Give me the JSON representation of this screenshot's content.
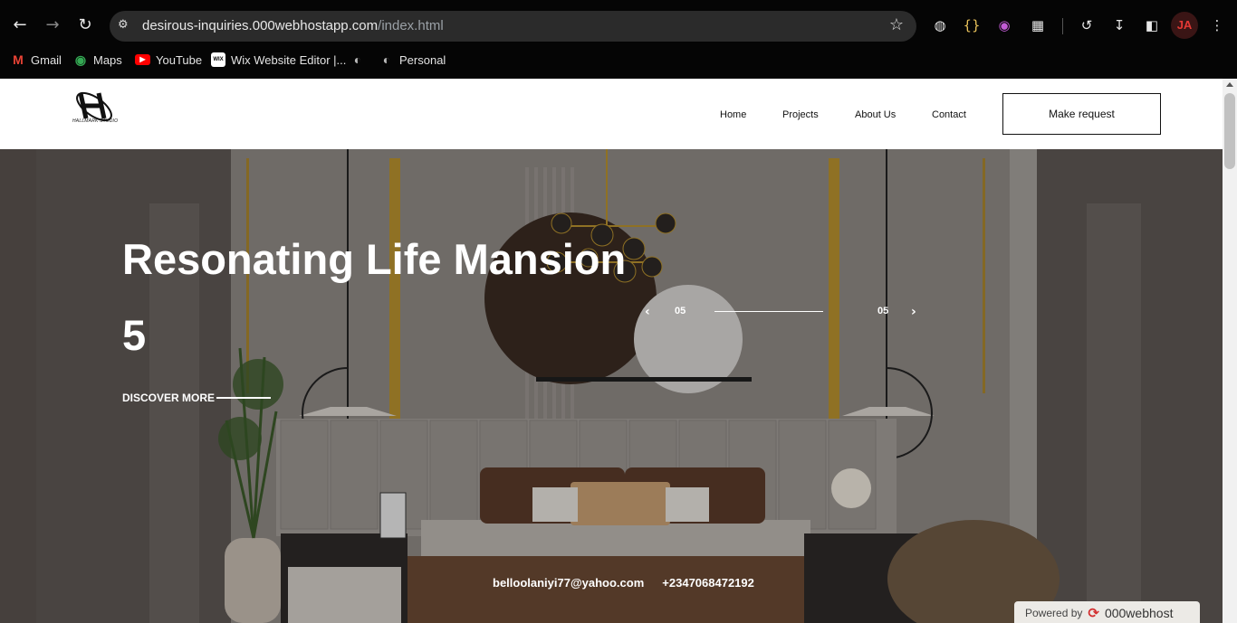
{
  "browser": {
    "url_host": "desirous-inquiries.000webhostapp.com",
    "url_path": "/index.html",
    "profile_initials": "JA",
    "bookmarks": [
      {
        "label": "Gmail",
        "icon": "gmail-icon"
      },
      {
        "label": "Maps",
        "icon": "maps-icon"
      },
      {
        "label": "YouTube",
        "icon": "youtube-icon"
      },
      {
        "label": "Wix Website Editor |...",
        "icon": "wix-icon"
      },
      {
        "label": "",
        "icon": "globe-icon"
      },
      {
        "label": "Personal",
        "icon": "globe-icon"
      }
    ],
    "extension_icons": [
      "circle-extension-icon",
      "braces-extension-icon",
      "broadcast-extension-icon",
      "puzzle-extensions-icon",
      "sync-icon",
      "download-icon",
      "sidepanel-icon",
      "menu-dots-icon"
    ]
  },
  "site": {
    "logo_text": "HALLMARK STUDIO",
    "nav": [
      "Home",
      "Projects",
      "About Us",
      "Contact"
    ],
    "cta": "Make request"
  },
  "hero": {
    "title": "Resonating Life Mansion 5",
    "discover": "DISCOVER MORE",
    "slide_current": "05",
    "slide_total": "05",
    "email": "belloolaniyi77@yahoo.com",
    "phone": "+2347068472192"
  },
  "powered": {
    "prefix": "Powered by",
    "brand": "000webhost"
  },
  "colors": {
    "chrome_bg": "#050505",
    "omnibox_bg": "#2b2b2b",
    "accent_gold": "#b8912f",
    "hero_wall": "#8f8985"
  }
}
